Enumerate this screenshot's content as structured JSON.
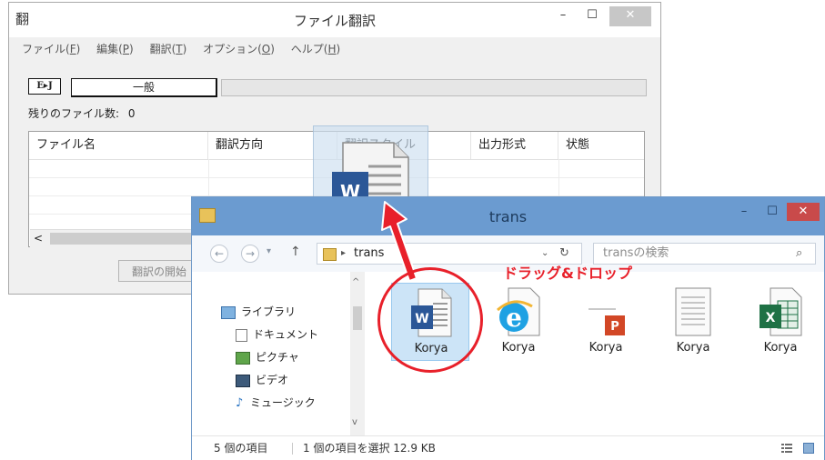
{
  "translation_window": {
    "title": "ファイル翻訳",
    "app_icon": "翻",
    "caption": {
      "minimize": "–",
      "maximize": "☐",
      "close": "✕"
    },
    "menu": [
      {
        "label": "ファイル(",
        "key": "F",
        "suffix": ")"
      },
      {
        "label": "編集(",
        "key": "P",
        "suffix": ")"
      },
      {
        "label": "翻訳(",
        "key": "T",
        "suffix": ")"
      },
      {
        "label": "オプション(",
        "key": "O",
        "suffix": ")"
      },
      {
        "label": "ヘルプ(",
        "key": "H",
        "suffix": ")"
      }
    ],
    "direction_badge": "E▸J",
    "mode": "一般",
    "remaining_label": "残りのファイル数:",
    "remaining_count": "0",
    "columns": [
      "ファイル名",
      "翻訳方向",
      "翻訳スタイル",
      "出力形式",
      "状態"
    ],
    "scroll_left": "<",
    "start_button": "翻訳の開始"
  },
  "explorer": {
    "title": "trans",
    "caption": {
      "minimize": "–",
      "maximize": "☐",
      "close": "✕"
    },
    "nav_back": "←",
    "nav_forward": "→",
    "nav_dropdown": "▾",
    "nav_up": "↑",
    "address_sep": "▸",
    "address_path": "trans",
    "address_dropdown": "⌄",
    "refresh": "↻",
    "search_placeholder": "transの検索",
    "search_icon": "⌕",
    "nav_pane": [
      {
        "label": "ライブラリ",
        "icon": "library-icon"
      },
      {
        "label": "ドキュメント",
        "icon": "document-icon"
      },
      {
        "label": "ピクチャ",
        "icon": "picture-icon"
      },
      {
        "label": "ビデオ",
        "icon": "video-icon"
      },
      {
        "label": "ミュージック",
        "icon": "music-icon"
      }
    ],
    "scroll_up": "^",
    "scroll_down": "v",
    "files": [
      {
        "name": "Korya",
        "icon": "word-icon",
        "selected": true
      },
      {
        "name": "Korya",
        "icon": "ie-icon",
        "selected": false
      },
      {
        "name": "Korya",
        "icon": "powerpoint-icon",
        "selected": false
      },
      {
        "name": "Korya",
        "icon": "text-file-icon",
        "selected": false
      },
      {
        "name": "Korya",
        "icon": "excel-icon",
        "selected": false
      }
    ],
    "status_count": "5 個の項目",
    "status_selected": "1 個の項目を選択  12.9 KB"
  },
  "annotation": {
    "drag_drop_label": "ドラッグ&ドロップ",
    "color": "#e8202a"
  },
  "colors": {
    "word_blue": "#2b5797",
    "excel_green": "#1e7145",
    "ppt_orange": "#d24726",
    "explorer_title": "#6b9bd0"
  }
}
